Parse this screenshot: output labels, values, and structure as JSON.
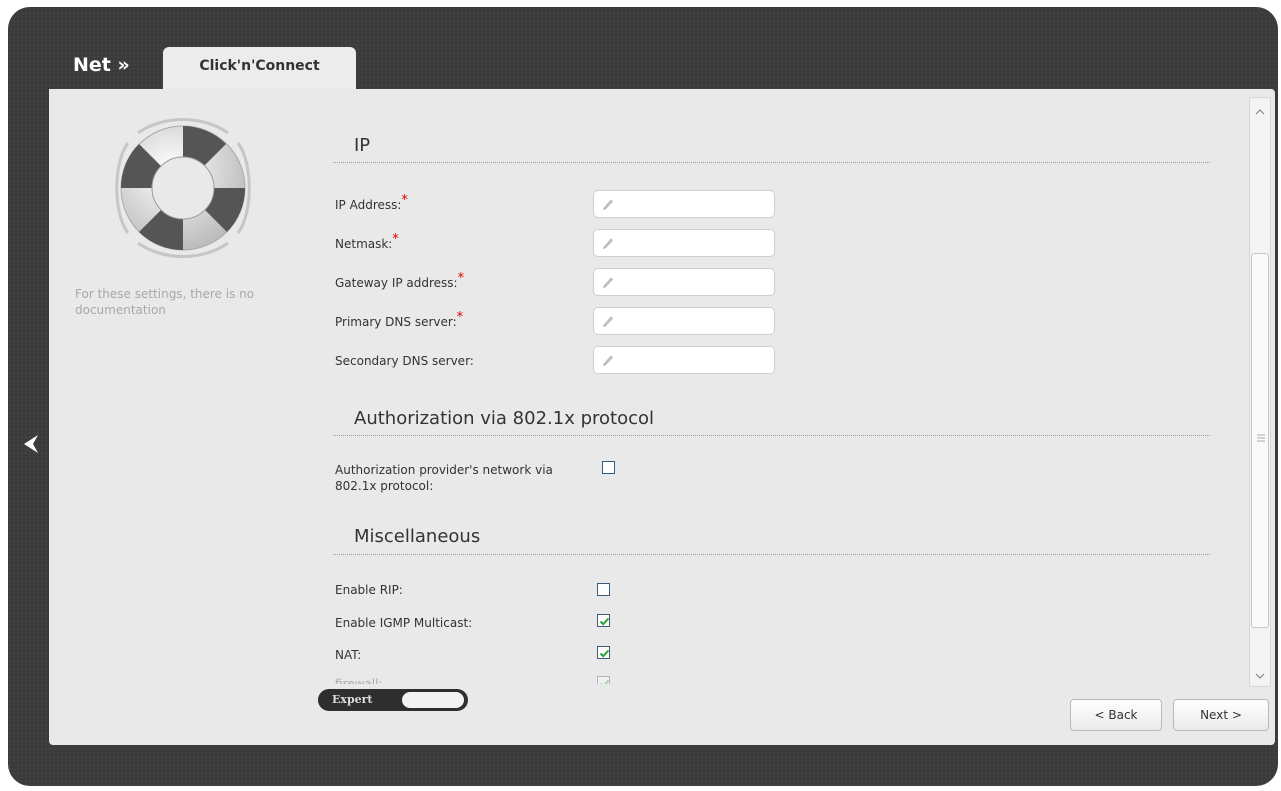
{
  "header": {
    "section_label": "Net »",
    "active_tab": "Click'n'Connect"
  },
  "sidebar": {
    "icon": "lifebuoy-icon",
    "note": "For these settings, there is no documentation"
  },
  "sections": {
    "ip": {
      "title": "IP",
      "fields": [
        {
          "label": "IP Address:",
          "required": "*",
          "value": ""
        },
        {
          "label": "Netmask:",
          "required": "*",
          "value": ""
        },
        {
          "label": "Gateway IP address:",
          "required": "*",
          "value": ""
        },
        {
          "label": "Primary DNS server:",
          "required": "*",
          "value": ""
        },
        {
          "label": "Secondary DNS server:",
          "required": "",
          "value": ""
        }
      ]
    },
    "auth": {
      "title": "Authorization via 802.1x protocol",
      "fields": [
        {
          "label": "Authorization provider's network via 802.1x protocol:",
          "checked": false
        }
      ]
    },
    "misc": {
      "title": "Miscellaneous",
      "fields": [
        {
          "label": "Enable RIP:",
          "checked": false
        },
        {
          "label": "Enable IGMP Multicast:",
          "checked": true
        },
        {
          "label": "NAT:",
          "checked": true
        },
        {
          "label": "firewall:",
          "checked": true
        }
      ]
    }
  },
  "footer": {
    "expert_label": "Expert",
    "back_label": "< Back",
    "next_label": "Next >"
  },
  "colors": {
    "required": "#e00000",
    "check": "#2ea02e",
    "frame": "#3b3b3b"
  }
}
